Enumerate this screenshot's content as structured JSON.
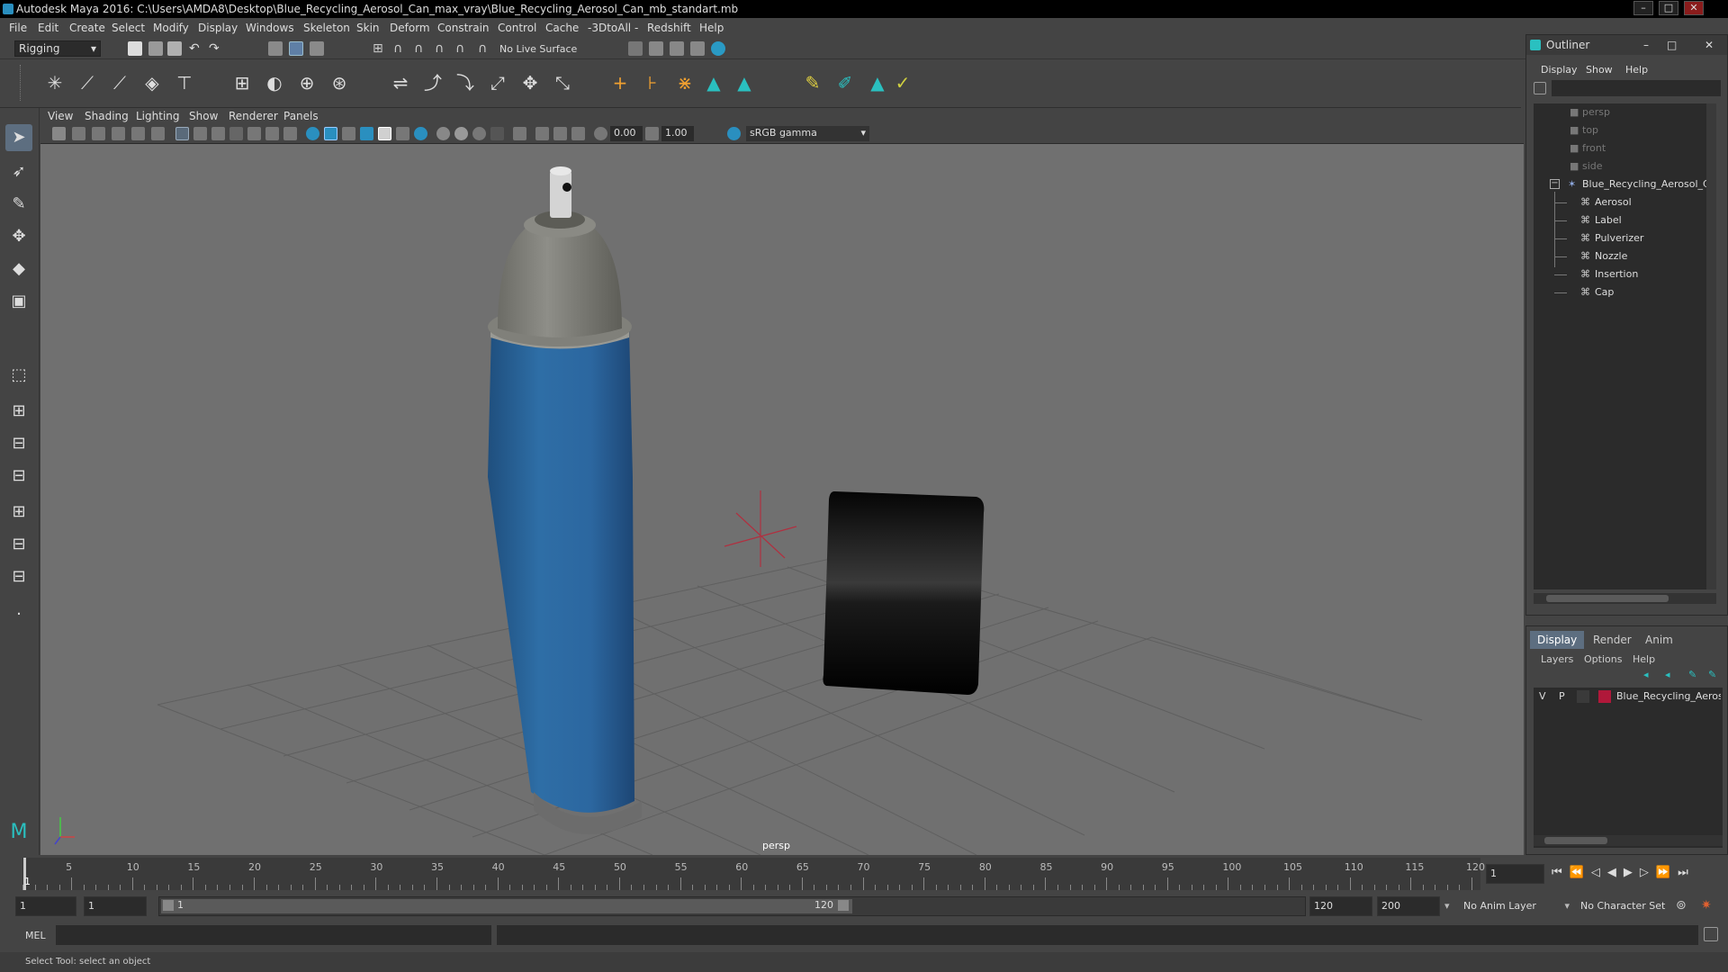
{
  "window": {
    "title": "Autodesk Maya 2016: C:\\Users\\AMDA8\\Desktop\\Blue_Recycling_Aerosol_Can_max_vray\\Blue_Recycling_Aerosol_Can_mb_standart.mb",
    "minimize": "–",
    "maximize": "□",
    "close": "✕"
  },
  "menubar": [
    "File",
    "Edit",
    "Create",
    "Select",
    "Modify",
    "Display",
    "Windows",
    "Skeleton",
    "Skin",
    "Deform",
    "Constrain",
    "Control",
    "Cache",
    "-3DtoAll -",
    "Redshift",
    "Help"
  ],
  "status_line": {
    "menu_set": "Rigging",
    "live_surface": "No Live Surface"
  },
  "viewport": {
    "menus": [
      "View",
      "Shading",
      "Lighting",
      "Show",
      "Renderer",
      "Panels"
    ],
    "exposure": "0.00",
    "gamma": "1.00",
    "color_space": "sRGB gamma",
    "camera_label": "persp"
  },
  "outliner": {
    "title": "Outliner",
    "menus": [
      "Display",
      "Show",
      "Help"
    ],
    "cameras": [
      "persp",
      "top",
      "front",
      "side"
    ],
    "group": "Blue_Recycling_Aerosol_Ca",
    "children": [
      "Aerosol",
      "Label",
      "Pulverizer",
      "Nozzle",
      "Insertion",
      "Cap"
    ]
  },
  "layer_editor": {
    "tabs": [
      "Display",
      "Render",
      "Anim"
    ],
    "menus": [
      "Layers",
      "Options",
      "Help"
    ],
    "layer": {
      "v": "V",
      "p": "P",
      "name": "Blue_Recycling_Aerosol",
      "color": "#b0183a"
    }
  },
  "timeline": {
    "ticks": [
      "5",
      "10",
      "15",
      "20",
      "25",
      "30",
      "35",
      "40",
      "45",
      "50",
      "55",
      "60",
      "65",
      "70",
      "75",
      "80",
      "85",
      "90",
      "95",
      "100",
      "105",
      "110",
      "115",
      "120"
    ],
    "current_frame": "1",
    "start_label": "1"
  },
  "range": {
    "start": "1",
    "playback_start": "1",
    "slider_start": "1",
    "slider_end": "120",
    "playback_end": "120",
    "end": "200",
    "anim_layer": "No Anim Layer",
    "character_set": "No Character Set"
  },
  "command": {
    "label": "MEL",
    "help": "Select Tool: select an object"
  },
  "colors": {
    "can_blue": "#2e6ea6",
    "cap_grey": "#8a8a84",
    "viewport_bg": "#707070"
  }
}
